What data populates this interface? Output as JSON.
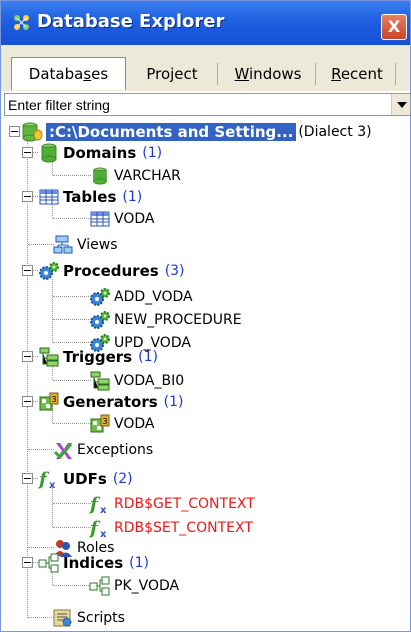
{
  "window": {
    "title": "Database Explorer",
    "close_label": "X"
  },
  "tabs": [
    {
      "pre": "Databa",
      "u": "s",
      "post": "es"
    },
    {
      "pre": "Pro",
      "u": "j",
      "post": "ect"
    },
    {
      "pre": "",
      "u": "W",
      "post": "indows"
    },
    {
      "pre": "",
      "u": "R",
      "post": "ecent"
    }
  ],
  "filter": {
    "value": "Enter filter string"
  },
  "tree": {
    "root": {
      "label": ":C:\\Documents and Setting...",
      "suffix": "(Dialect 3)"
    },
    "domains": {
      "label": "Domains",
      "count": "(1)",
      "items": [
        "VARCHAR"
      ]
    },
    "tables": {
      "label": "Tables",
      "count": "(1)",
      "items": [
        "VODA"
      ]
    },
    "views": {
      "label": "Views"
    },
    "procedures": {
      "label": "Procedures",
      "count": "(3)",
      "items": [
        "ADD_VODA",
        "NEW_PROCEDURE",
        "UPD_VODA"
      ]
    },
    "triggers": {
      "label": "Triggers",
      "count": "(1)",
      "items": [
        "VODA_BI0"
      ]
    },
    "generators": {
      "label": "Generators",
      "count": "(1)",
      "items": [
        "VODA"
      ]
    },
    "exceptions": {
      "label": "Exceptions"
    },
    "udfs": {
      "label": "UDFs",
      "count": "(2)",
      "items": [
        "RDB$GET_CONTEXT",
        "RDB$SET_CONTEXT"
      ]
    },
    "roles": {
      "label": "Roles"
    },
    "indices": {
      "label": "Indices",
      "count": "(1)",
      "items": [
        "PK_VODA"
      ]
    },
    "scripts": {
      "label": "Scripts"
    }
  },
  "colors": {
    "titlebar": "#1f5fe0",
    "selection": "#3162c4",
    "count": "#1c3ad8",
    "udf_item": "#f01818"
  }
}
